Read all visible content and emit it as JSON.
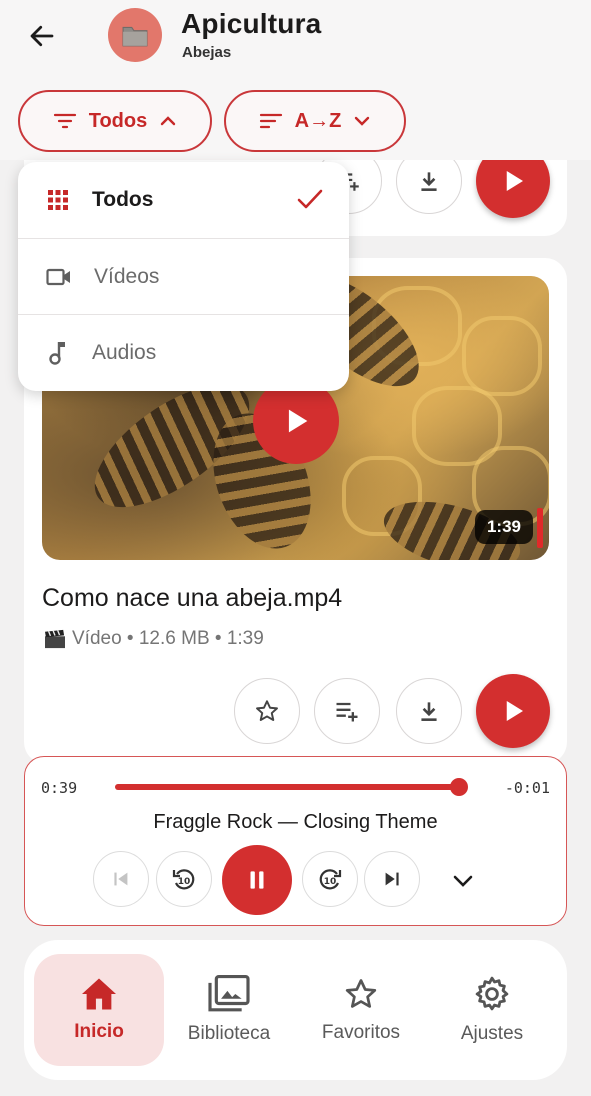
{
  "header": {
    "title": "Apicultura",
    "subtitle": "Abejas",
    "back_icon": "arrow-left-icon",
    "avatar_icon": "folder-icon"
  },
  "filters": {
    "type_label": "Todos",
    "sort_label": "A→Z"
  },
  "dropdown": {
    "items": [
      {
        "label": "Todos",
        "icon": "grid-icon",
        "selected": true
      },
      {
        "label": "Vídeos",
        "icon": "videocam-icon",
        "selected": false
      },
      {
        "label": "Audios",
        "icon": "music-note-icon",
        "selected": false
      }
    ]
  },
  "media_card": {
    "title": "Como nace una abeja.mp4",
    "meta_icon": "clapper-board-icon",
    "meta": "Vídeo • 12.6 MB • 1:39",
    "duration": "1:39"
  },
  "player": {
    "current_time": "0:39",
    "remaining_time": "-0:01",
    "progress": 0.99,
    "track_title": "Fraggle Rock — Closing Theme"
  },
  "nav": {
    "items": [
      {
        "label": "Inicio",
        "icon": "home-icon",
        "active": true
      },
      {
        "label": "Biblioteca",
        "icon": "photo-library-icon",
        "active": false
      },
      {
        "label": "Favoritos",
        "icon": "star-icon",
        "active": false
      },
      {
        "label": "Ajustes",
        "icon": "gear-icon",
        "active": false
      }
    ]
  },
  "colors": {
    "accent": "#d32f2f",
    "accent_light": "#f8e1e1",
    "avatar": "#e2776b"
  }
}
